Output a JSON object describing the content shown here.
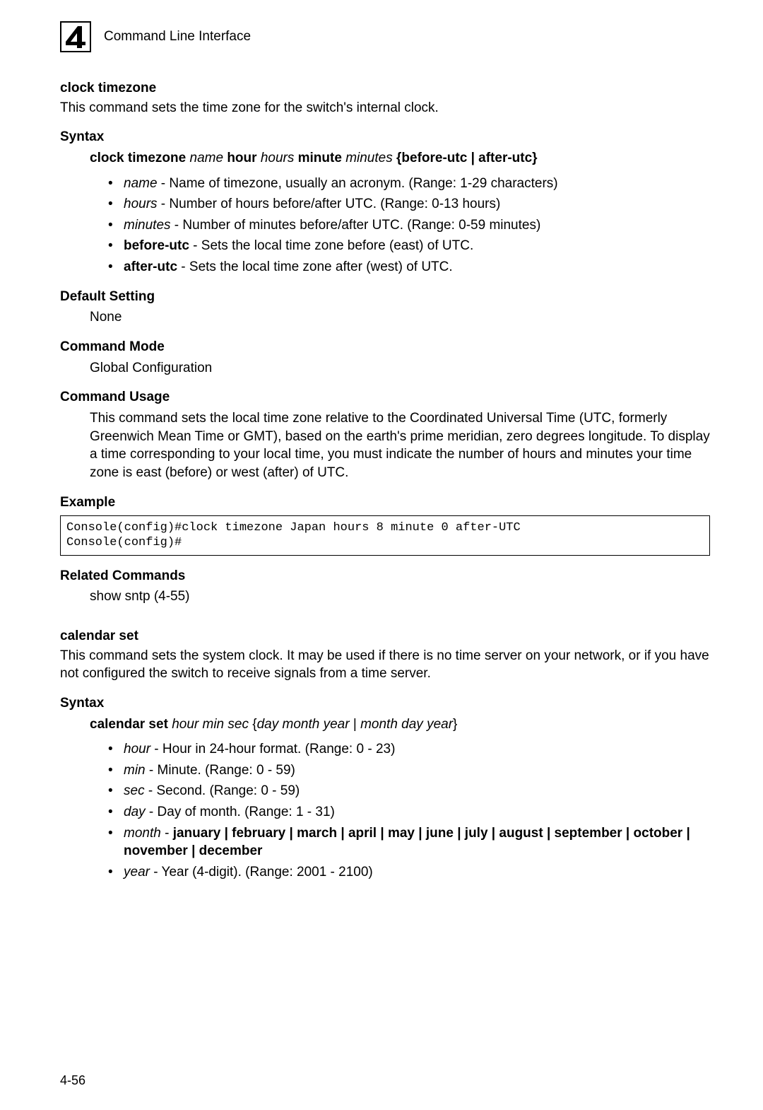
{
  "header": {
    "chapter_num": "4",
    "title": "Command Line Interface"
  },
  "sec1": {
    "title": "clock timezone",
    "desc": "This command sets the time zone for the switch's internal clock.",
    "syntax_label": "Syntax",
    "syntax_b1": "clock timezone",
    "syntax_i1": "name",
    "syntax_b2": "hour",
    "syntax_i2": "hours",
    "syntax_b3": "minute",
    "syntax_i3": "minutes",
    "syntax_b4": "{before-utc | after-utc}",
    "p_name_t": "name",
    "p_name_d": " - Name of timezone, usually an acronym. (Range: 1-29 characters)",
    "p_hours_t": "hours",
    "p_hours_d": " - Number of hours before/after UTC. (Range: 0-13 hours)",
    "p_minutes_t": "minutes",
    "p_minutes_d": " - Number of minutes before/after UTC. (Range: 0-59 minutes)",
    "p_before_t": "before-utc",
    "p_before_d": " - Sets the local time zone before (east) of UTC.",
    "p_after_t": "after-utc",
    "p_after_d": " - Sets the local time zone after (west) of UTC.",
    "def_label": "Default Setting",
    "def_val": "None",
    "mode_label": "Command Mode",
    "mode_val": "Global Configuration",
    "usage_label": "Command Usage",
    "usage_val": "This command sets the local time zone relative to the Coordinated Universal Time (UTC, formerly Greenwich Mean Time or GMT), based on the earth's prime meridian, zero degrees longitude. To display a time corresponding to your local time, you must indicate the number of hours and minutes your time zone is east (before) or west (after) of UTC.",
    "ex_label": "Example",
    "ex_val": "Console(config)#clock timezone Japan hours 8 minute 0 after-UTC\nConsole(config)#",
    "rel_label": "Related Commands",
    "rel_val": "show sntp (4-55)"
  },
  "sec2": {
    "title": "calendar set",
    "desc": "This command sets the system clock. It may be used if there is no time server on your network, or if you have not configured the switch to receive signals from a time server.",
    "syntax_label": "Syntax",
    "syntax_b1": "calendar set",
    "syntax_i1": "hour min sec",
    "syntax_b2": "{",
    "syntax_i2": "day month year",
    "syntax_b3": " | ",
    "syntax_i3": "month day year",
    "syntax_b4": "}",
    "p_hour_t": "hour",
    "p_hour_d": " - Hour in 24-hour format. (Range: 0 - 23)",
    "p_min_t": "min",
    "p_min_d": " - Minute. (Range: 0 - 59)",
    "p_sec_t": "sec",
    "p_sec_d": " - Second. (Range: 0 - 59)",
    "p_day_t": "day",
    "p_day_d": " - Day of month. (Range: 1 - 31)",
    "p_month_t": "month",
    "p_month_d1": " - ",
    "p_month_b": "january | february | march | april | may | june | july | august | september | october | november | december",
    "p_year_t": "year",
    "p_year_d": " - Year (4-digit). (Range: 2001 - 2100)"
  },
  "page_num": "4-56"
}
